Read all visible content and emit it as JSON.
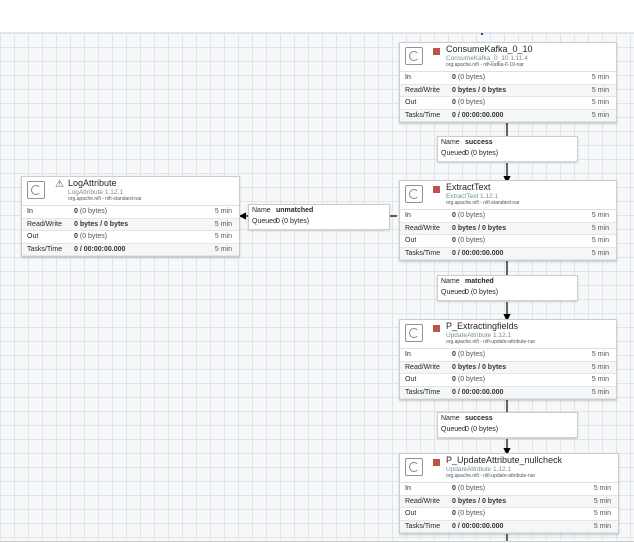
{
  "canvas": {
    "processors": [
      {
        "name": "ConsumeKafka_0_10",
        "type": "ConsumeKafka_0_10 1.11.4",
        "bundle": "org.apache.nifi - nifi-kafka-0-10-nar",
        "state": "stopped",
        "stats": [
          {
            "label": "In",
            "value": "0",
            "extra": "(0 bytes)",
            "window": "5 min"
          },
          {
            "label": "Read/Write",
            "value": "0 bytes / 0 bytes",
            "extra": "",
            "window": "5 min"
          },
          {
            "label": "Out",
            "value": "0",
            "extra": "(0 bytes)",
            "window": "5 min"
          },
          {
            "label": "Tasks/Time",
            "value": "0 / 00:00:00.000",
            "extra": "",
            "window": "5 min"
          }
        ]
      },
      {
        "name": "LogAttribute",
        "type": "LogAttribute 1.12.1",
        "bundle": "org.apache.nifi - nifi-standard-nar",
        "state": "invalid",
        "stats": [
          {
            "label": "In",
            "value": "0",
            "extra": "(0 bytes)",
            "window": "5 min"
          },
          {
            "label": "Read/Write",
            "value": "0 bytes / 0 bytes",
            "extra": "",
            "window": "5 min"
          },
          {
            "label": "Out",
            "value": "0",
            "extra": "(0 bytes)",
            "window": "5 min"
          },
          {
            "label": "Tasks/Time",
            "value": "0 / 00:00:00.000",
            "extra": "",
            "window": "5 min"
          }
        ]
      },
      {
        "name": "ExtractText",
        "type": "ExtractText 1.12.1",
        "bundle": "org.apache.nifi - nifi-standard-nar",
        "state": "stopped",
        "stats": [
          {
            "label": "In",
            "value": "0",
            "extra": "(0 bytes)",
            "window": "5 min"
          },
          {
            "label": "Read/Write",
            "value": "0 bytes / 0 bytes",
            "extra": "",
            "window": "5 min"
          },
          {
            "label": "Out",
            "value": "0",
            "extra": "(0 bytes)",
            "window": "5 min"
          },
          {
            "label": "Tasks/Time",
            "value": "0 / 00:00:00.000",
            "extra": "",
            "window": "5 min"
          }
        ]
      },
      {
        "name": "P_Extractingfields",
        "type": "UpdateAttribute 1.12.1",
        "bundle": "org.apache.nifi - nifi-update-attribute-nar",
        "state": "stopped",
        "stats": [
          {
            "label": "In",
            "value": "0",
            "extra": "(0 bytes)",
            "window": "5 min"
          },
          {
            "label": "Read/Write",
            "value": "0 bytes / 0 bytes",
            "extra": "",
            "window": "5 min"
          },
          {
            "label": "Out",
            "value": "0",
            "extra": "(0 bytes)",
            "window": "5 min"
          },
          {
            "label": "Tasks/Time",
            "value": "0 / 00:00:00.000",
            "extra": "",
            "window": "5 min"
          }
        ]
      },
      {
        "name": "P_UpdateAttribute_nullcheck",
        "type": "UpdateAttribute 1.12.1",
        "bundle": "org.apache.nifi - nifi-update-attribute-nar",
        "state": "stopped",
        "stats": [
          {
            "label": "In",
            "value": "0",
            "extra": "(0 bytes)",
            "window": "5 min"
          },
          {
            "label": "Read/Write",
            "value": "0 bytes / 0 bytes",
            "extra": "",
            "window": "5 min"
          },
          {
            "label": "Out",
            "value": "0",
            "extra": "(0 bytes)",
            "window": "5 min"
          },
          {
            "label": "Tasks/Time",
            "value": "0 / 00:00:00.000",
            "extra": "",
            "window": "5 min"
          }
        ]
      }
    ],
    "connections": [
      {
        "name_label": "Name",
        "name": "success",
        "queued_label": "Queued",
        "queued": "0 (0 bytes)"
      },
      {
        "name_label": "Name",
        "name": "unmatched",
        "queued_label": "Queued",
        "queued": "0 (0 bytes)"
      },
      {
        "name_label": "Name",
        "name": "matched",
        "queued_label": "Queued",
        "queued": "0 (0 bytes)"
      },
      {
        "name_label": "Name",
        "name": "success",
        "queued_label": "Queued",
        "queued": "0 (0 bytes)"
      }
    ],
    "colors": {
      "stopped": "#ba554a",
      "type_text": "#728e9b",
      "grid": "#e2e5e8",
      "edge": "#000000"
    }
  }
}
